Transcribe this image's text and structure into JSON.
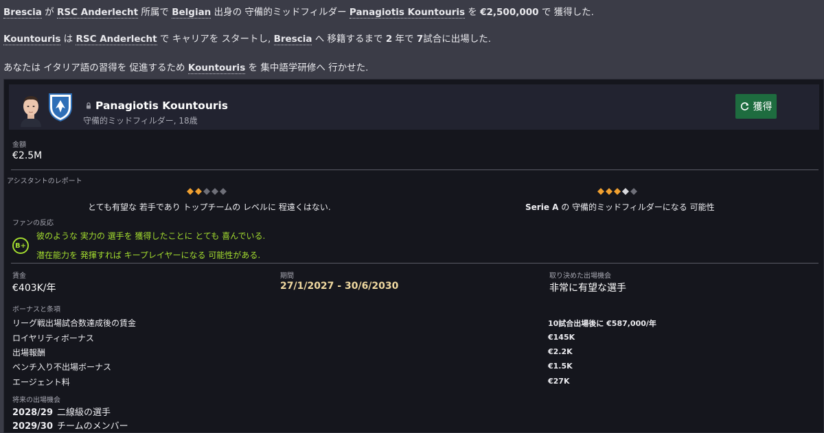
{
  "news": {
    "line1": {
      "club": "Brescia",
      "p1": " が ",
      "from_club": "RSC Anderlecht",
      "p2": " 所属で ",
      "nation": "Belgian",
      "p3": " 出身の 守備的ミッドフィルダー ",
      "player": "Panagiotis Kountouris",
      "p4": " を ",
      "fee": "€2,500,000",
      "p5": " で 獲得した."
    },
    "line2": {
      "player": "Kountouris",
      "p1": " は ",
      "from_club": "RSC Anderlecht",
      "p2": " で キャリアを スタートし, ",
      "club": "Brescia",
      "p3": " へ 移籍するまで ",
      "years": "2",
      "p4": " 年で ",
      "apps": "7",
      "p5": "試合に出場した."
    },
    "line3": {
      "p1": "あなたは イタリア語の習得を 促進するため ",
      "player": "Kountouris",
      "p2": " を 集中語学研修へ 行かせた."
    }
  },
  "player": {
    "name": "Panagiotis Kountouris",
    "subtitle": "守備的ミッドフィルダー, 18歳",
    "sign_button": "獲得",
    "icons": {
      "face": "player-face",
      "crest": "club-crest",
      "lock": "lock-icon",
      "refresh": "refresh-icon"
    }
  },
  "fee": {
    "label": "金額",
    "value": "€2.5M"
  },
  "assistant_report": {
    "label": "アシスタントのレポート",
    "current": {
      "stars_filled": 2,
      "stars_half": 0,
      "stars_total": 5,
      "text": "とても有望な 若手であり トップチームの レベルに 程遠くはない."
    },
    "potential": {
      "stars_filled": 3,
      "stars_half": 1,
      "stars_total": 5,
      "text_bold": "Serie A",
      "text": " の 守備的ミッドフィルダーになる 可能性"
    }
  },
  "fan_reaction": {
    "label": "ファンの反応",
    "grade": "B+",
    "lines": [
      "彼のような 実力の 選手を 獲得したことに とても 喜んでいる.",
      "潜在能力を 発揮すれば キープレイヤーになる 可能性がある."
    ]
  },
  "contract": {
    "wage": {
      "label": "賃金",
      "value": "€403K/年"
    },
    "period": {
      "label": "期間",
      "value": "27/1/2027 - 30/6/2030"
    },
    "playing_time": {
      "label": "取り決めた出場機会",
      "value": "非常に有望な選手"
    }
  },
  "bonuses": {
    "label": "ボーナスと条項",
    "rows": [
      {
        "name": "リーグ戦出場試合数達成後の賃金",
        "value": "10試合出場後に €587,000/年"
      },
      {
        "name": "ロイヤリティボーナス",
        "value": "€145K"
      },
      {
        "name": "出場報酬",
        "value": "€2.2K"
      },
      {
        "name": "ベンチ入り不出場ボーナス",
        "value": "€1.5K"
      },
      {
        "name": "エージェント料",
        "value": "€27K"
      }
    ]
  },
  "future": {
    "label": "将来の出場機会",
    "rows": [
      {
        "season": "2028/29",
        "role": "二線級の選手"
      },
      {
        "season": "2029/30",
        "role": "チームのメンバー"
      }
    ]
  },
  "colors": {
    "accent_green": "#1e6c3f",
    "fan_green": "#a4dd2f",
    "star_gold": "#f0a030",
    "star_grey": "#6e6f78",
    "value_gold": "#f0d9a0"
  }
}
